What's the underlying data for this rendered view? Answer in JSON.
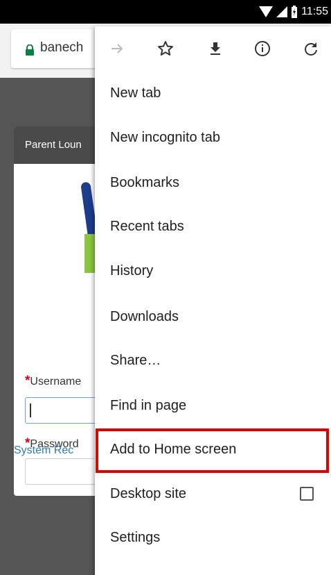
{
  "status_bar": {
    "time": "11:55"
  },
  "browser": {
    "url": "banech"
  },
  "page": {
    "card_title": "Parent Loun",
    "username_label": "Username",
    "password_label": "Password",
    "system_link": "System Rec",
    "required_marker": "*"
  },
  "menu": {
    "top_icons": [
      "forward-arrow-icon",
      "star-icon",
      "download-icon",
      "info-icon",
      "refresh-icon"
    ],
    "items": [
      {
        "label": "New tab"
      },
      {
        "label": "New incognito tab"
      },
      {
        "label": "Bookmarks"
      },
      {
        "label": "Recent tabs"
      },
      {
        "label": "History"
      },
      {
        "label": "Downloads"
      },
      {
        "label": "Share…"
      },
      {
        "label": "Find in page"
      },
      {
        "label": "Add to Home screen"
      },
      {
        "label": "Desktop site"
      },
      {
        "label": "Settings"
      }
    ],
    "desktop_site_checked": false
  },
  "colors": {
    "highlight": "#e00000",
    "link": "#2a7ab8",
    "required": "#d0021b",
    "lock": "#0b8043"
  }
}
